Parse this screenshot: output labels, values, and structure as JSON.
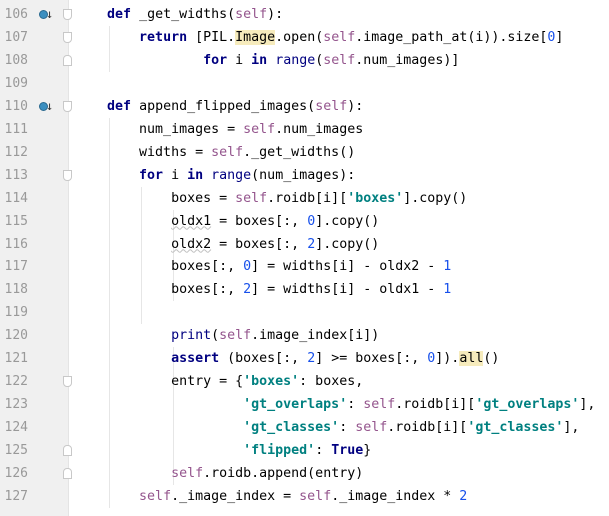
{
  "editor": {
    "colors": {
      "keyword": "#000080",
      "self": "#94558d",
      "string": "#008080",
      "number": "#1750eb",
      "highlight": "#f6ebbc",
      "gutter": "#f0f0f0"
    },
    "lines": [
      {
        "num": "106",
        "marker": "override-icon",
        "fold": "start",
        "tokens": [
          [
            "t",
            "    "
          ],
          [
            "k",
            "def"
          ],
          [
            "t",
            " _get_widths("
          ],
          [
            "s",
            "self"
          ],
          [
            "t",
            "):"
          ]
        ]
      },
      {
        "num": "107",
        "fold": "start",
        "tokens": [
          [
            "t",
            "        "
          ],
          [
            "k",
            "return"
          ],
          [
            "t",
            " [PIL."
          ],
          [
            "h",
            "Image"
          ],
          [
            "t",
            ".open("
          ],
          [
            "s",
            "self"
          ],
          [
            "t",
            ".image_path_at(i)).size["
          ],
          [
            "n",
            "0"
          ],
          [
            "t",
            "]"
          ]
        ]
      },
      {
        "num": "108",
        "fold": "end",
        "tokens": [
          [
            "t",
            "                "
          ],
          [
            "k",
            "for"
          ],
          [
            "t",
            " i "
          ],
          [
            "k",
            "in"
          ],
          [
            "t",
            " "
          ],
          [
            "b",
            "range"
          ],
          [
            "t",
            "("
          ],
          [
            "s",
            "self"
          ],
          [
            "t",
            ".num_images)]"
          ]
        ]
      },
      {
        "num": "109",
        "tokens": []
      },
      {
        "num": "110",
        "marker": "override-icon",
        "fold": "start",
        "tokens": [
          [
            "t",
            "    "
          ],
          [
            "k",
            "def"
          ],
          [
            "t",
            " append_flipped_images("
          ],
          [
            "s",
            "self"
          ],
          [
            "t",
            "):"
          ]
        ]
      },
      {
        "num": "111",
        "tokens": [
          [
            "t",
            "        num_images = "
          ],
          [
            "s",
            "self"
          ],
          [
            "t",
            ".num_images"
          ]
        ]
      },
      {
        "num": "112",
        "tokens": [
          [
            "t",
            "        widths = "
          ],
          [
            "s",
            "self"
          ],
          [
            "t",
            "._get_widths()"
          ]
        ]
      },
      {
        "num": "113",
        "fold": "start",
        "tokens": [
          [
            "t",
            "        "
          ],
          [
            "k",
            "for"
          ],
          [
            "t",
            " i "
          ],
          [
            "k",
            "in"
          ],
          [
            "t",
            " "
          ],
          [
            "b",
            "range"
          ],
          [
            "t",
            "(num_images):"
          ]
        ]
      },
      {
        "num": "114",
        "tokens": [
          [
            "t",
            "            boxes = "
          ],
          [
            "s",
            "self"
          ],
          [
            "t",
            ".roidb[i]["
          ],
          [
            "str",
            "'boxes'"
          ],
          [
            "t",
            "].copy()"
          ]
        ]
      },
      {
        "num": "115",
        "tokens": [
          [
            "t",
            "            "
          ],
          [
            "w",
            "oldx1"
          ],
          [
            "t",
            " = boxes[:, "
          ],
          [
            "n",
            "0"
          ],
          [
            "t",
            "].copy()"
          ]
        ]
      },
      {
        "num": "116",
        "tokens": [
          [
            "t",
            "            "
          ],
          [
            "w",
            "oldx2"
          ],
          [
            "t",
            " = boxes[:, "
          ],
          [
            "n",
            "2"
          ],
          [
            "t",
            "].copy()"
          ]
        ]
      },
      {
        "num": "117",
        "tokens": [
          [
            "t",
            "            boxes[:, "
          ],
          [
            "n",
            "0"
          ],
          [
            "t",
            "] = widths[i] - oldx2 - "
          ],
          [
            "n",
            "1"
          ]
        ]
      },
      {
        "num": "118",
        "tokens": [
          [
            "t",
            "            boxes[:, "
          ],
          [
            "n",
            "2"
          ],
          [
            "t",
            "] = widths[i] - oldx1 - "
          ],
          [
            "n",
            "1"
          ]
        ]
      },
      {
        "num": "119",
        "tokens": []
      },
      {
        "num": "120",
        "tokens": [
          [
            "t",
            "            "
          ],
          [
            "b",
            "print"
          ],
          [
            "t",
            "("
          ],
          [
            "s",
            "self"
          ],
          [
            "t",
            ".image_index[i])"
          ]
        ]
      },
      {
        "num": "121",
        "tokens": [
          [
            "t",
            "            "
          ],
          [
            "k",
            "assert"
          ],
          [
            "t",
            " (boxes[:, "
          ],
          [
            "n",
            "2"
          ],
          [
            "t",
            "] >= boxes[:, "
          ],
          [
            "n",
            "0"
          ],
          [
            "t",
            "])."
          ],
          [
            "h",
            "all"
          ],
          [
            "t",
            "()"
          ]
        ]
      },
      {
        "num": "122",
        "fold": "start",
        "tokens": [
          [
            "t",
            "            entry = {"
          ],
          [
            "str",
            "'boxes'"
          ],
          [
            "t",
            ": boxes,"
          ]
        ]
      },
      {
        "num": "123",
        "tokens": [
          [
            "t",
            "                     "
          ],
          [
            "str",
            "'gt_overlaps'"
          ],
          [
            "t",
            ": "
          ],
          [
            "s",
            "self"
          ],
          [
            "t",
            ".roidb[i]["
          ],
          [
            "str",
            "'gt_overlaps'"
          ],
          [
            "t",
            "],"
          ]
        ]
      },
      {
        "num": "124",
        "tokens": [
          [
            "t",
            "                     "
          ],
          [
            "str",
            "'gt_classes'"
          ],
          [
            "t",
            ": "
          ],
          [
            "s",
            "self"
          ],
          [
            "t",
            ".roidb[i]["
          ],
          [
            "str",
            "'gt_classes'"
          ],
          [
            "t",
            "],"
          ]
        ]
      },
      {
        "num": "125",
        "fold": "end",
        "tokens": [
          [
            "t",
            "                     "
          ],
          [
            "str",
            "'flipped'"
          ],
          [
            "t",
            ": "
          ],
          [
            "k",
            "True"
          ],
          [
            "t",
            "}"
          ]
        ]
      },
      {
        "num": "126",
        "fold": "end",
        "tokens": [
          [
            "t",
            "            "
          ],
          [
            "s",
            "self"
          ],
          [
            "t",
            ".roidb.append(entry)"
          ]
        ]
      },
      {
        "num": "127",
        "tokens": [
          [
            "t",
            "        "
          ],
          [
            "s",
            "self"
          ],
          [
            "t",
            "._image_index = "
          ],
          [
            "s",
            "self"
          ],
          [
            "t",
            "._image_index * "
          ],
          [
            "n",
            "2"
          ]
        ]
      }
    ]
  }
}
